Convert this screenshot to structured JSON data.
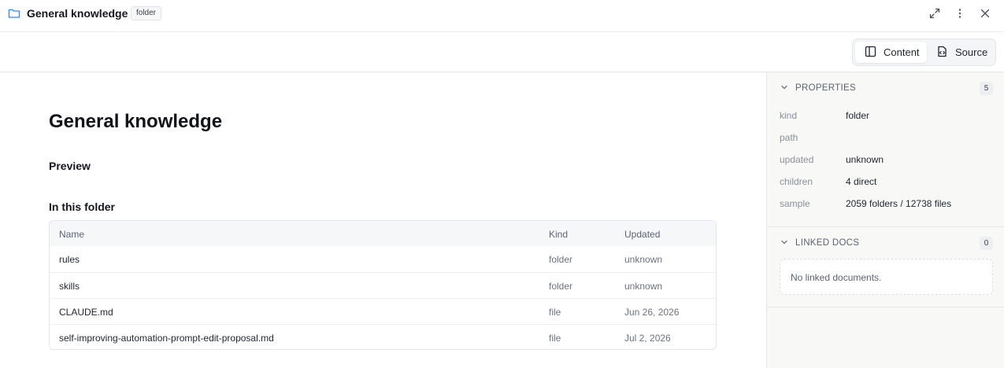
{
  "header": {
    "title": "General knowledge",
    "badge": "folder"
  },
  "toolbar": {
    "content_label": "Content",
    "source_label": "Source",
    "active": "Content"
  },
  "main": {
    "title": "General knowledge",
    "preview_heading": "Preview",
    "folder_heading": "In this folder",
    "table": {
      "columns": [
        "Name",
        "Kind",
        "Updated"
      ],
      "rows": [
        {
          "name": "rules",
          "kind": "folder",
          "updated": "unknown"
        },
        {
          "name": "skills",
          "kind": "folder",
          "updated": "unknown"
        },
        {
          "name": "CLAUDE.md",
          "kind": "file",
          "updated": "Jun 26, 2026"
        },
        {
          "name": "self-improving-automation-prompt-edit-proposal.md",
          "kind": "file",
          "updated": "Jul 2, 2026"
        }
      ]
    }
  },
  "sidebar": {
    "properties": {
      "label": "PROPERTIES",
      "count": "5",
      "items": [
        {
          "key": "kind",
          "value": "folder"
        },
        {
          "key": "path",
          "value": ""
        },
        {
          "key": "updated",
          "value": "unknown"
        },
        {
          "key": "children",
          "value": "4 direct"
        },
        {
          "key": "sample",
          "value": "2059 folders / 12738 files"
        }
      ]
    },
    "linked": {
      "label": "LINKED DOCS",
      "count": "0",
      "empty_text": "No linked documents."
    }
  },
  "colors": {
    "accent_folder_icon": "#3b82f6",
    "text_primary": "#1f2430",
    "text_muted": "#6b7280",
    "sidebar_bg": "#f8f8f6"
  }
}
